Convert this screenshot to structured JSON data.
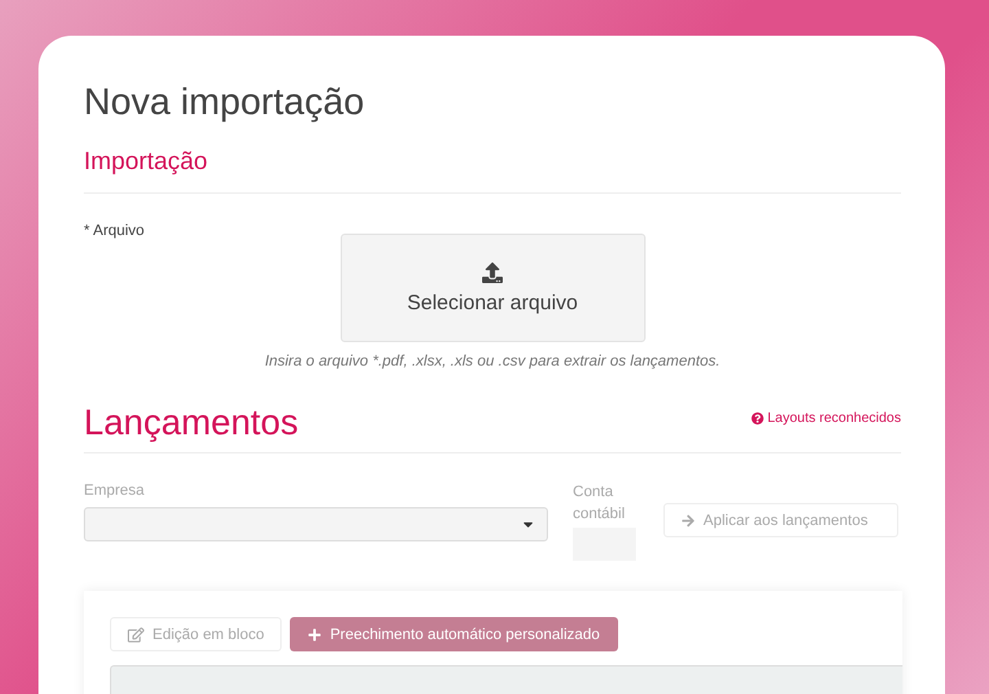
{
  "page": {
    "title": "Nova importação"
  },
  "import_section": {
    "title": "Importação",
    "file_label": "* Arquivo",
    "upload_button": "Selecionar arquivo",
    "hint": "Insira o arquivo *.pdf, .xlsx, .xls ou .csv para extrair os lançamentos."
  },
  "entries_section": {
    "title": "Lançamentos",
    "help_link": "Layouts reconhecidos",
    "company_field": {
      "label": "Empresa",
      "disabled": true
    },
    "account_field": {
      "label": "Conta contábil",
      "disabled": true
    },
    "apply_button": {
      "label": "Aplicar aos lançamentos",
      "disabled": true
    },
    "toolbar": [
      {
        "kind": "edit",
        "label": "Edição em bloco",
        "disabled": true
      },
      {
        "kind": "add",
        "label": "Preechimento automático personalizado",
        "disabled": true
      }
    ]
  }
}
